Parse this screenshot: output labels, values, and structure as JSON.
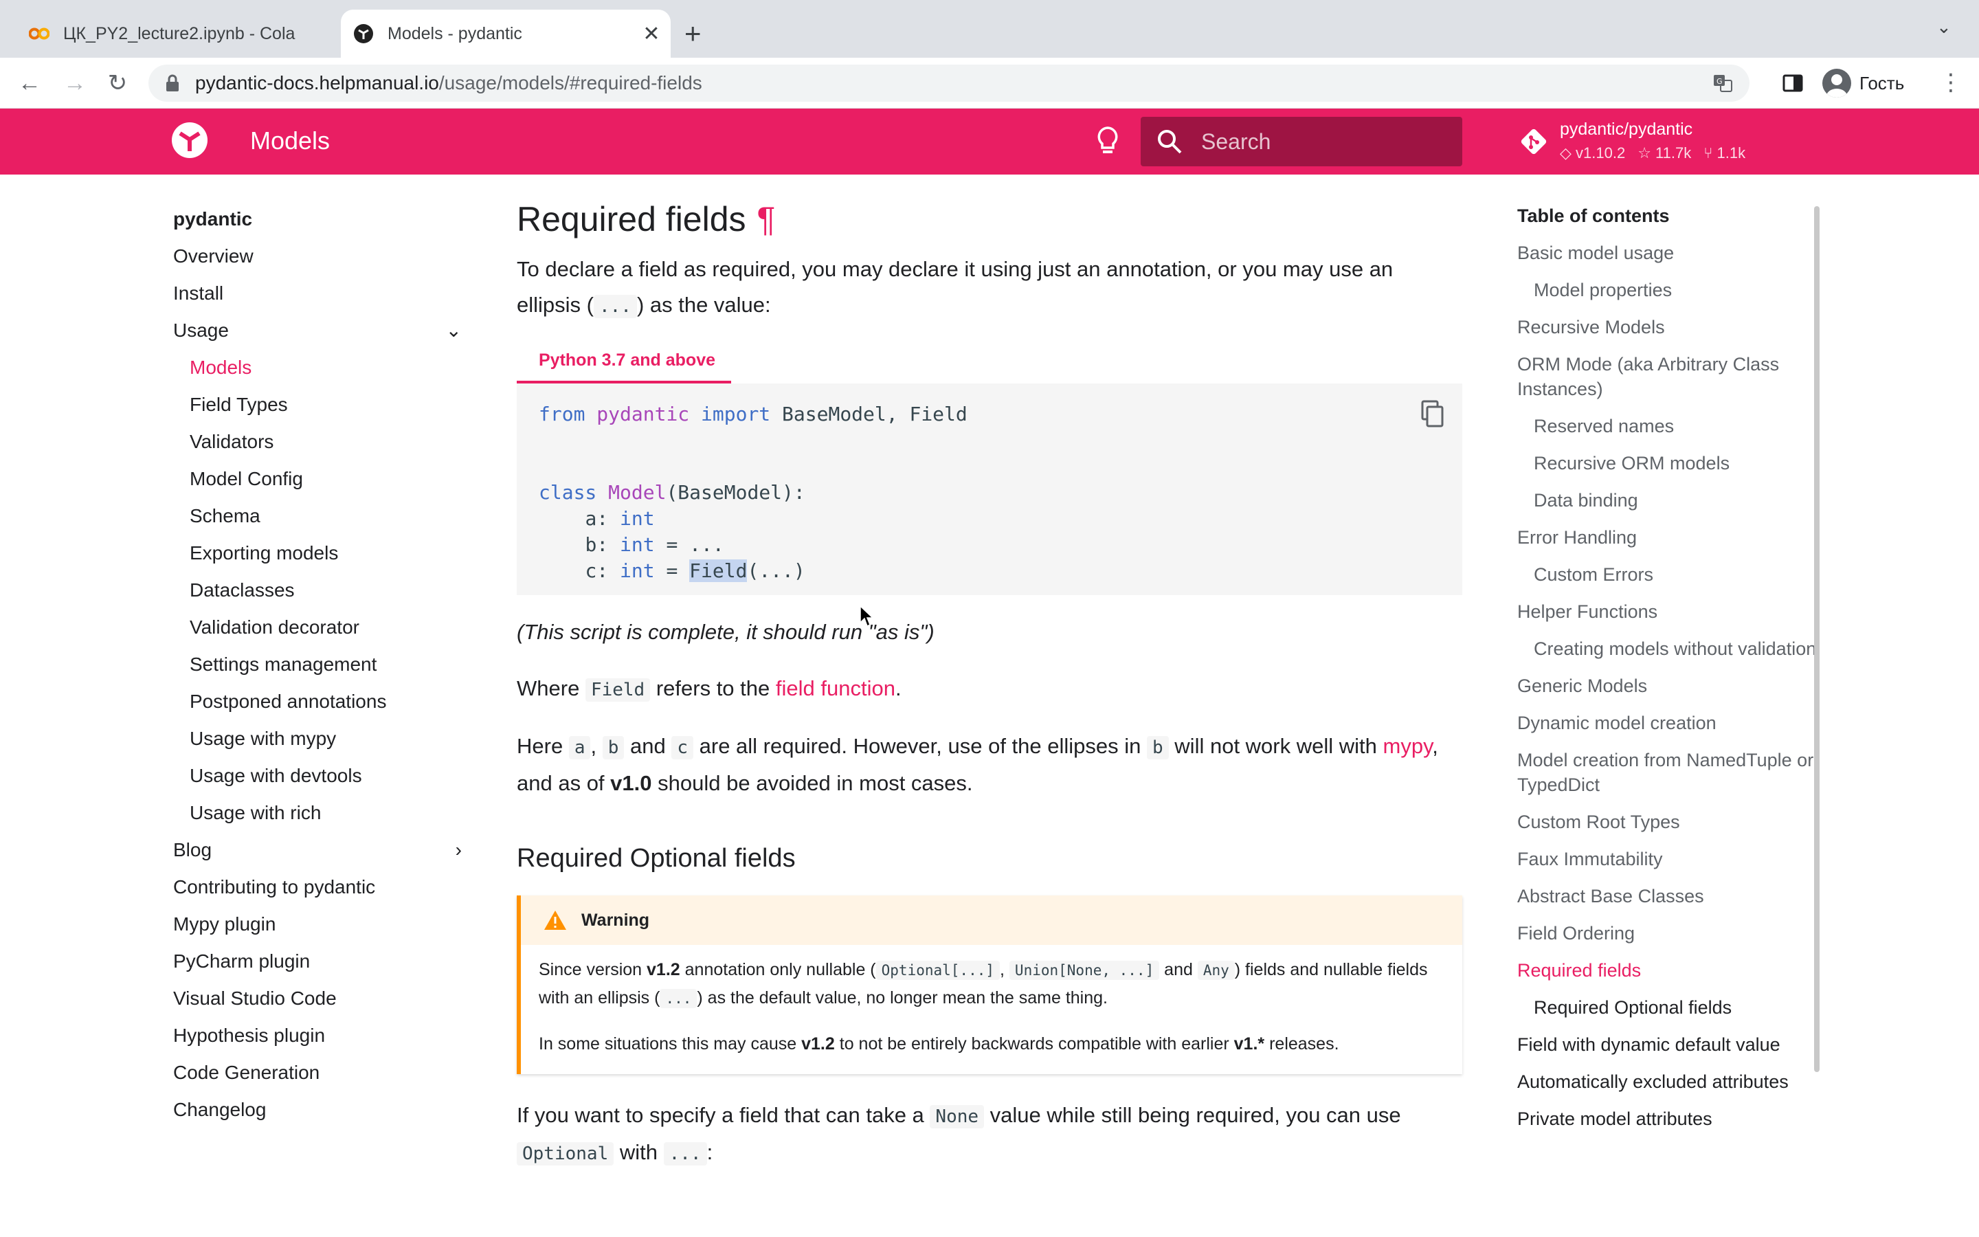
{
  "browser": {
    "tabs": [
      {
        "title": "ЦК_PY2_lecture2.ipynb - Cola",
        "favicon": "colab-icon"
      },
      {
        "title": "Models - pydantic",
        "favicon": "pydantic-icon"
      }
    ],
    "url_host": "pydantic-docs.helpmanual.io",
    "url_path": "/usage/models/#required-fields",
    "profile_name": "Гость"
  },
  "header": {
    "title": "Models",
    "search_placeholder": "Search",
    "repo_name": "pydantic/pydantic",
    "repo_version": "v1.10.2",
    "repo_stars": "11.7k",
    "repo_forks": "1.1k",
    "brand_color": "#e91e63"
  },
  "nav": {
    "title": "pydantic",
    "items": [
      {
        "label": "Overview"
      },
      {
        "label": "Install"
      },
      {
        "label": "Usage",
        "expanded": true
      },
      {
        "label": "Models",
        "sub": true,
        "active": true
      },
      {
        "label": "Field Types",
        "sub": true
      },
      {
        "label": "Validators",
        "sub": true
      },
      {
        "label": "Model Config",
        "sub": true
      },
      {
        "label": "Schema",
        "sub": true
      },
      {
        "label": "Exporting models",
        "sub": true
      },
      {
        "label": "Dataclasses",
        "sub": true
      },
      {
        "label": "Validation decorator",
        "sub": true
      },
      {
        "label": "Settings management",
        "sub": true
      },
      {
        "label": "Postponed annotations",
        "sub": true
      },
      {
        "label": "Usage with mypy",
        "sub": true
      },
      {
        "label": "Usage with devtools",
        "sub": true
      },
      {
        "label": "Usage with rich",
        "sub": true
      },
      {
        "label": "Blog",
        "collapsed": true
      },
      {
        "label": "Contributing to pydantic"
      },
      {
        "label": "Mypy plugin"
      },
      {
        "label": "PyCharm plugin"
      },
      {
        "label": "Visual Studio Code"
      },
      {
        "label": "Hypothesis plugin"
      },
      {
        "label": "Code Generation"
      },
      {
        "label": "Changelog"
      }
    ]
  },
  "content": {
    "heading": "Required fields",
    "pilcrow": "¶",
    "intro_1": "To declare a field as required, you may declare it using just an annotation, or you may use an",
    "intro_2a": "ellipsis (",
    "intro_code": "...",
    "intro_2b": ") as the value:",
    "code_tab": "Python 3.7 and above",
    "code": {
      "l1_from": "from",
      "l1_mod": "pydantic",
      "l1_import": "import",
      "l1_rest": "BaseModel, Field",
      "l2_class": "class",
      "l2_name": "Model",
      "l2_rest": "(BaseModel):",
      "l3": "a",
      "l4": "b",
      "l5": "c",
      "type_int": "int",
      "ellipsis": "...",
      "field_call": "Field",
      "field_args": "(...)"
    },
    "script_note": "(This script is complete, it should run \"as is\")",
    "where_a": "Where",
    "where_code": "Field",
    "where_b": "refers to the",
    "where_link": "field function",
    "where_c": ".",
    "here_a": "Here",
    "here_code_a": "a",
    "here_code_b": "b",
    "here_code_c": "c",
    "here_and": "and",
    "here_b": "are all required. However, use of the ellipses in",
    "here_c": "will not work well with",
    "here_link": "mypy",
    "here_d": "and as of",
    "here_bold": "v1.0",
    "here_e": "should be avoided in most cases.",
    "subheading": "Required Optional fields",
    "warning": {
      "title": "Warning",
      "p1_a": "Since version",
      "p1_bold": "v1.2",
      "p1_b": "annotation only nullable (",
      "p1_code1": "Optional[...]",
      "p1_code2": "Union[None, ...]",
      "p1_and": "and",
      "p1_code3": "Any",
      "p1_c": ") fields and nullable fields",
      "p1_d": "with an ellipsis (",
      "p1_code4": "...",
      "p1_e": ") as the default value, no longer mean the same thing.",
      "p2_a": "In some situations this may cause",
      "p2_bold1": "v1.2",
      "p2_b": "to not be entirely backwards compatible with earlier",
      "p2_bold2": "v1.*",
      "p2_c": "releases."
    },
    "last_a": "If you want to specify a field that can take a",
    "last_code1": "None",
    "last_b": "value while still being required, you can use",
    "last_code2": "Optional",
    "last_c": "with",
    "last_code3": "...",
    "last_d": ":"
  },
  "toc": {
    "title": "Table of contents",
    "items": [
      {
        "label": "Basic model usage"
      },
      {
        "label": "Model properties",
        "sub": true
      },
      {
        "label": "Recursive Models"
      },
      {
        "label": "ORM Mode (aka Arbitrary Class Instances)"
      },
      {
        "label": "Reserved names",
        "sub": true
      },
      {
        "label": "Recursive ORM models",
        "sub": true
      },
      {
        "label": "Data binding",
        "sub": true
      },
      {
        "label": "Error Handling"
      },
      {
        "label": "Custom Errors",
        "sub": true
      },
      {
        "label": "Helper Functions"
      },
      {
        "label": "Creating models without validation",
        "sub": true
      },
      {
        "label": "Generic Models"
      },
      {
        "label": "Dynamic model creation"
      },
      {
        "label": "Model creation from NamedTuple or TypedDict"
      },
      {
        "label": "Custom Root Types"
      },
      {
        "label": "Faux Immutability"
      },
      {
        "label": "Abstract Base Classes"
      },
      {
        "label": "Field Ordering"
      },
      {
        "label": "Required fields",
        "active": true
      },
      {
        "label": "Required Optional fields",
        "sub": true,
        "dark": true
      },
      {
        "label": "Field with dynamic default value",
        "dark": true
      },
      {
        "label": "Automatically excluded attributes",
        "dark": true
      },
      {
        "label": "Private model attributes",
        "dark": true
      }
    ]
  }
}
